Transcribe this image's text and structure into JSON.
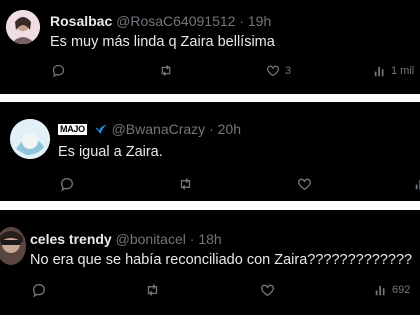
{
  "tweets": [
    {
      "display_name": "Rosalbac",
      "handle": "@RosaC64091512",
      "separator": "·",
      "time": "19h",
      "text": "Es muy más linda q Zaira  bellísima",
      "likes": "3",
      "views": "1 mil",
      "avatar_colors": [
        "#d9c9c2",
        "#f3dfe5"
      ]
    },
    {
      "display_name_logo": "MAJO",
      "handle": "@BwanaCrazy",
      "separator": "·",
      "time": "20h",
      "text": "Es igual a Zaira.",
      "avatar_colors": [
        "#cfe7f3",
        "#a9cfe6"
      ]
    },
    {
      "display_name": "celes trendy",
      "handle": "@bonitacel",
      "separator": "·",
      "time": "18h",
      "text": "No era que se había reconciliado con Zaira?????????????",
      "views": "692",
      "avatar_colors": [
        "#3b2d2a",
        "#b59a8a"
      ]
    }
  ],
  "icons": [
    "reply-icon",
    "retweet-icon",
    "like-icon",
    "views-icon",
    "verified-icon"
  ],
  "colors": {
    "muted": "#71767b",
    "text": "#e7e9ea",
    "background": "#000000",
    "divider": "#ffffff"
  }
}
